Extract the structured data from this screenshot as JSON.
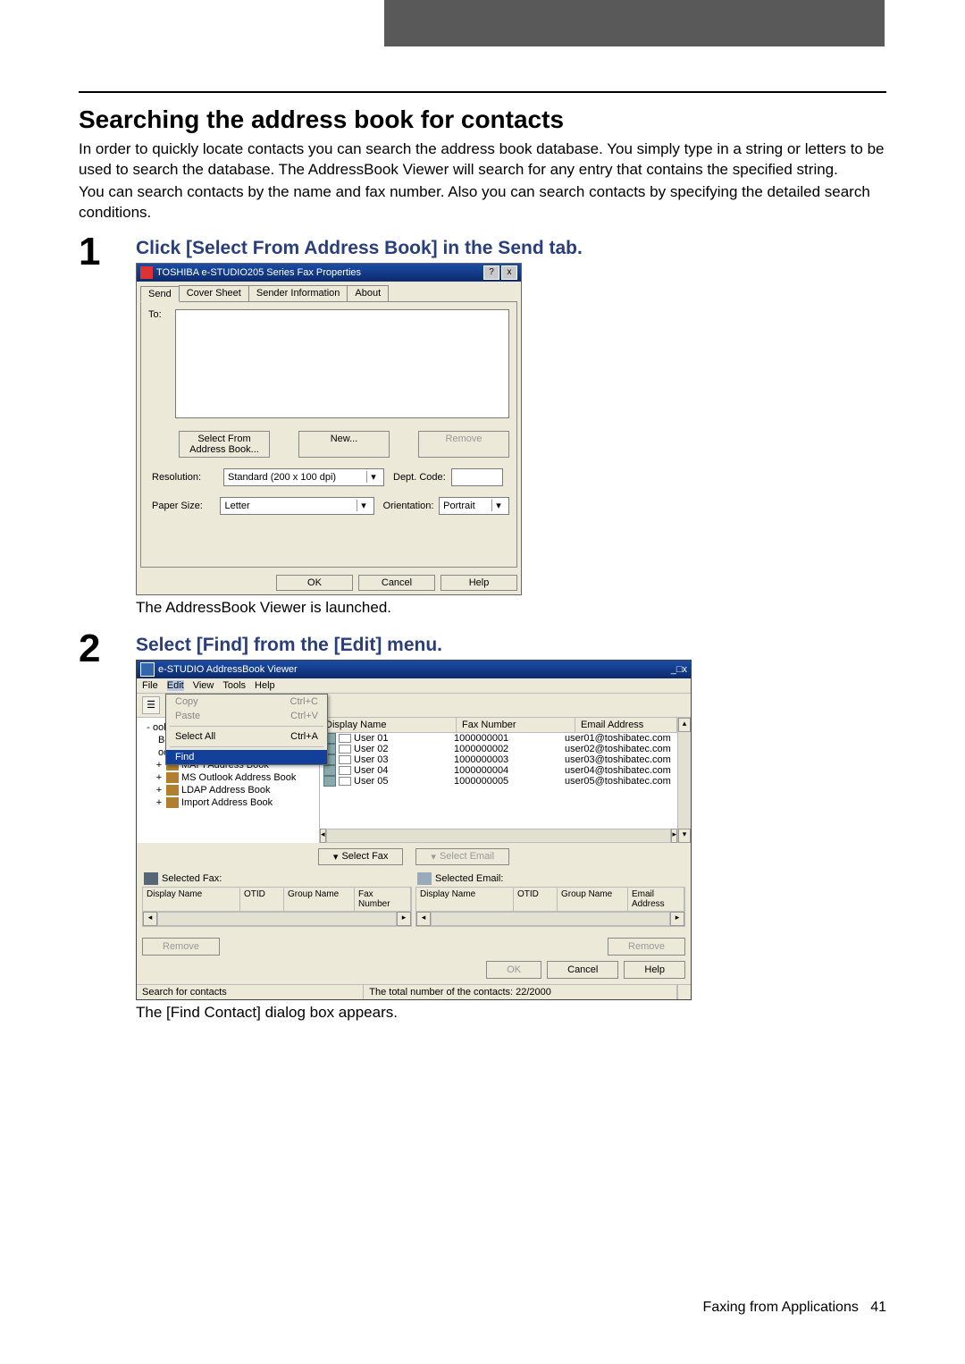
{
  "page": {
    "heading": "Searching the address book for contacts",
    "intro1": "In order to quickly locate contacts you can search the address book database. You simply type in a string or letters to be used to search the database. The AddressBook Viewer will search for any entry that contains the specified string.",
    "intro2": "You can search contacts by the name and fax number. Also you can search contacts by specifying the detailed search conditions.",
    "footer_text": "Faxing from Applications",
    "footer_page": "41"
  },
  "step1": {
    "num": "1",
    "title": "Click [Select From Address Book] in the Send tab.",
    "after": "The AddressBook Viewer is launched."
  },
  "step2": {
    "num": "2",
    "title": "Select [Find] from the [Edit] menu.",
    "after": "The [Find Contact] dialog box appears."
  },
  "faxprops": {
    "title": "TOSHIBA e-STUDIO205 Series Fax Properties",
    "tabs": {
      "send": "Send",
      "cover": "Cover Sheet",
      "sender": "Sender Information",
      "about": "About"
    },
    "to_label": "To:",
    "btn_select": "Select From Address Book...",
    "btn_new": "New...",
    "btn_remove": "Remove",
    "res_label": "Resolution:",
    "res_value": "Standard (200 x 100 dpi)",
    "dept_label": "Dept. Code:",
    "paper_label": "Paper Size:",
    "paper_value": "Letter",
    "orient_label": "Orientation:",
    "orient_value": "Portrait",
    "ok": "OK",
    "cancel": "Cancel",
    "help": "Help"
  },
  "abv": {
    "title": "e-STUDIO AddressBook Viewer",
    "menu": {
      "file": "File",
      "edit": "Edit",
      "view": "View",
      "tools": "Tools",
      "help": "Help"
    },
    "editmenu": {
      "copy": "Copy",
      "copy_sc": "Ctrl+C",
      "paste": "Paste",
      "paste_sc": "Ctrl+V",
      "selectall": "Select All",
      "selectall_sc": "Ctrl+A",
      "find": "Find"
    },
    "tree": {
      "root_suffix": "ook",
      "book_suffix1": "Book",
      "book_suffix2": "ook",
      "mapi": "MAPI Address Book",
      "outlook": "MS Outlook Address Book",
      "ldap": "LDAP Address Book",
      "import": "Import Address Book"
    },
    "grid": {
      "col_disp": "Display Name",
      "col_fax": "Fax Number",
      "col_email": "Email Address",
      "rows": [
        {
          "name": "User 01",
          "fax": "1000000001",
          "email": "user01@toshibatec.com"
        },
        {
          "name": "User 02",
          "fax": "1000000002",
          "email": "user02@toshibatec.com"
        },
        {
          "name": "User 03",
          "fax": "1000000003",
          "email": "user03@toshibatec.com"
        },
        {
          "name": "User 04",
          "fax": "1000000004",
          "email": "user04@toshibatec.com"
        },
        {
          "name": "User 05",
          "fax": "1000000005",
          "email": "user05@toshibatec.com"
        }
      ]
    },
    "selectfax": "Select Fax",
    "selectemail": "Select Email",
    "sel_fax_title": "Selected Fax:",
    "sel_email_title": "Selected Email:",
    "sel_cols": {
      "disp": "Display Name",
      "otid": "OTID",
      "group": "Group Name",
      "fax": "Fax Number",
      "email": "Email Address"
    },
    "remove": "Remove",
    "ok": "OK",
    "cancel": "Cancel",
    "help": "Help",
    "status_left": "Search for contacts",
    "status_right": "The total number of the contacts: 22/2000"
  }
}
